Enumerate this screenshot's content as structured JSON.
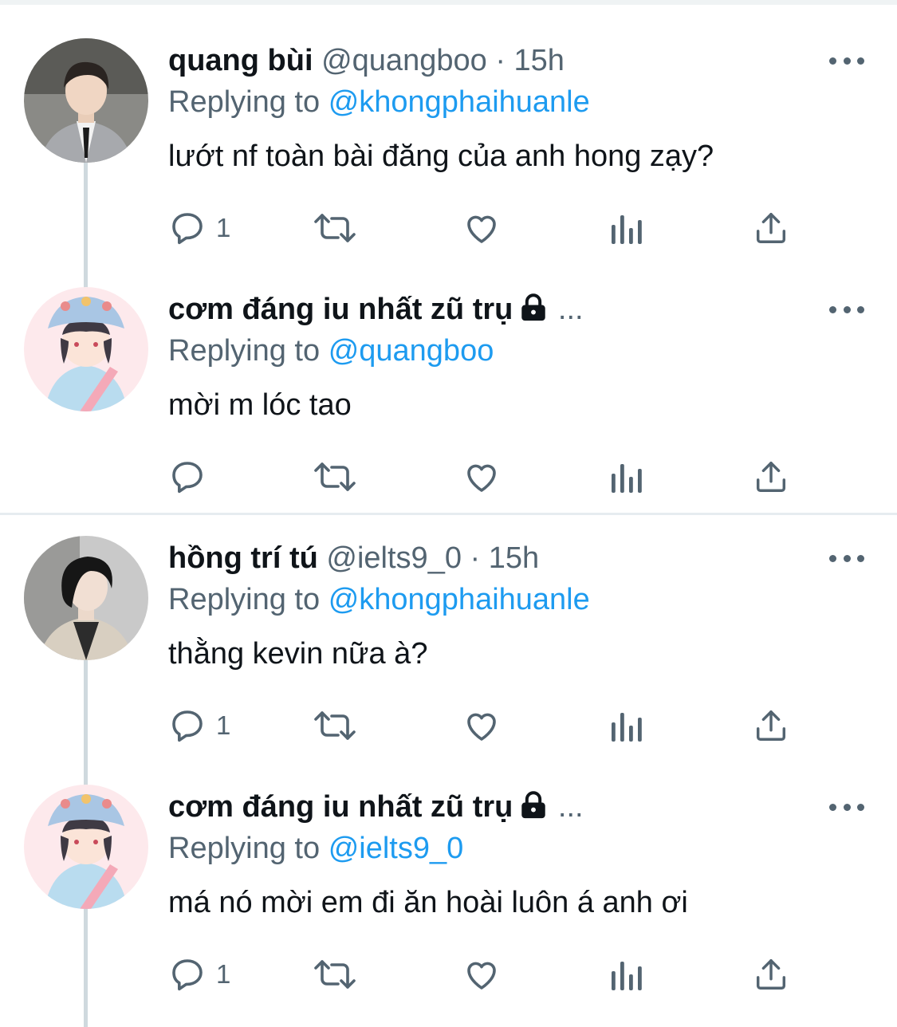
{
  "tweets": [
    {
      "name": "quang bùi",
      "handle": "@quangboo",
      "separator": "·",
      "time": "15h",
      "replying_prefix": "Replying to",
      "reply_to": "@khongphaihuanle",
      "text": "lướt nf toàn bài đăng của anh hong zạy?",
      "reply_count": "1",
      "avatar": "man-in-suit-photo"
    },
    {
      "name": "cơm đáng iu nhất zũ trụ",
      "protected_icon": "lock-icon",
      "truncation": "...",
      "replying_prefix": "Replying to",
      "reply_to": "@quangboo",
      "text": "mời m lóc tao",
      "reply_count": "",
      "avatar": "anime-bucket-hat-illustration"
    },
    {
      "name": "hồng trí tú",
      "handle": "@ielts9_0",
      "separator": "·",
      "time": "15h",
      "replying_prefix": "Replying to",
      "reply_to": "@khongphaihuanle",
      "text": "thằng kevin nữa à?",
      "reply_count": "1",
      "avatar": "man-dark-hair-photo"
    },
    {
      "name": "cơm đáng iu nhất zũ trụ",
      "protected_icon": "lock-icon",
      "truncation": "...",
      "replying_prefix": "Replying to",
      "reply_to": "@ielts9_0",
      "text": "má nó mời em đi ăn hoài luôn á anh ơi",
      "reply_count": "1",
      "avatar": "anime-bucket-hat-illustration"
    }
  ],
  "icons": {
    "more": "more-horizontal-icon",
    "reply": "reply-bubble-icon",
    "retweet": "retweet-icon",
    "like": "heart-icon",
    "views": "analytics-bars-icon",
    "share": "share-upload-icon"
  },
  "colors": {
    "text": "#0f1419",
    "secondary": "#536471",
    "link": "#1d9bf0",
    "thread_line": "#cfd9de"
  }
}
